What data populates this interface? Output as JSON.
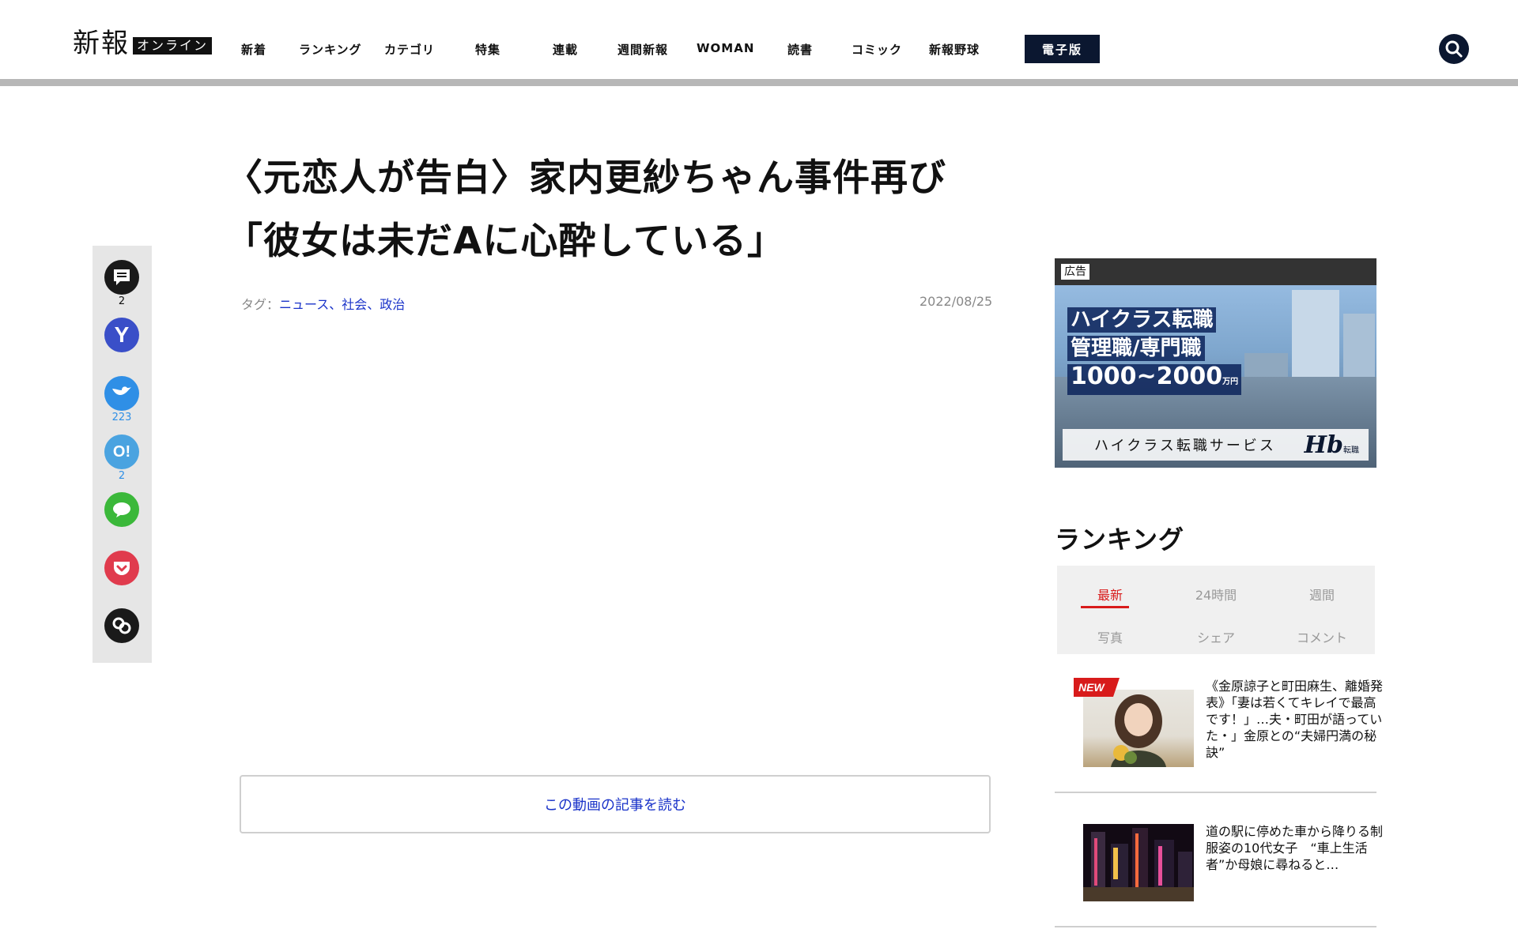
{
  "header": {
    "logo_main": "新報",
    "logo_sub": "オンライン",
    "nav": [
      "新着",
      "ランキング",
      "カテゴリ",
      "特集",
      "連載",
      "週間新報",
      "WOMAN",
      "読書",
      "コミック",
      "新報野球"
    ],
    "edition_label": "電子版",
    "search_icon": "search-icon"
  },
  "share": {
    "comments": {
      "icon": "comment-icon",
      "count": "2"
    },
    "yahoo": {
      "icon": "y-icon",
      "letter": "Y"
    },
    "twitter": {
      "icon": "bird-icon",
      "count": "223"
    },
    "hatena": {
      "icon": "o-exclaim-icon",
      "letter": "O!",
      "count": "2"
    },
    "line": {
      "icon": "line-bubble-icon"
    },
    "pocket": {
      "icon": "pocket-icon"
    },
    "link": {
      "icon": "link-icon"
    },
    "colors": {
      "twitter": "#2f8fe6",
      "hatena": "#4aa3e0",
      "line": "#3bb83a",
      "pocket": "#e03b4d",
      "dark": "#1a1a1a"
    }
  },
  "article": {
    "title_line1": "〈元恋人が告白〉家内更紗ちゃん事件再び",
    "title_line2": "「彼女は未だAに心酔している」",
    "tag_prefix": "タグ：",
    "tags": [
      "ニュース",
      "社会",
      "政治"
    ],
    "tag_separator": "、",
    "date": "2022/08/25",
    "read_button": "この動画の記事を読む"
  },
  "ad": {
    "label": "広告",
    "line1": "ハイクラス転職",
    "line2": "管理職/専門職",
    "line3": "1000~2000",
    "line3_unit": "万円",
    "footer_text": "ハイクラス転職サービス",
    "logo": "Hb",
    "logo_sub": "転職"
  },
  "ranking": {
    "title": "ランキング",
    "tabs_row1": [
      "最新",
      "24時間",
      "週間"
    ],
    "tabs_row2": [
      "写真",
      "シェア",
      "コメント"
    ],
    "active_tab": "最新",
    "items": [
      {
        "badge": "NEW",
        "text": "《金原諒子と町田麻生、離婚発表》「妻は若くてキレイで最高です！」…夫・町田が語っていた・」金原との“夫婦円満の秘訣”"
      },
      {
        "badge": "",
        "text": "道の駅に停めた車から降りる制服姿の10代女子　“車上生活者”か母娘に尋ねると…"
      }
    ],
    "accent_color": "#d81b1b"
  }
}
